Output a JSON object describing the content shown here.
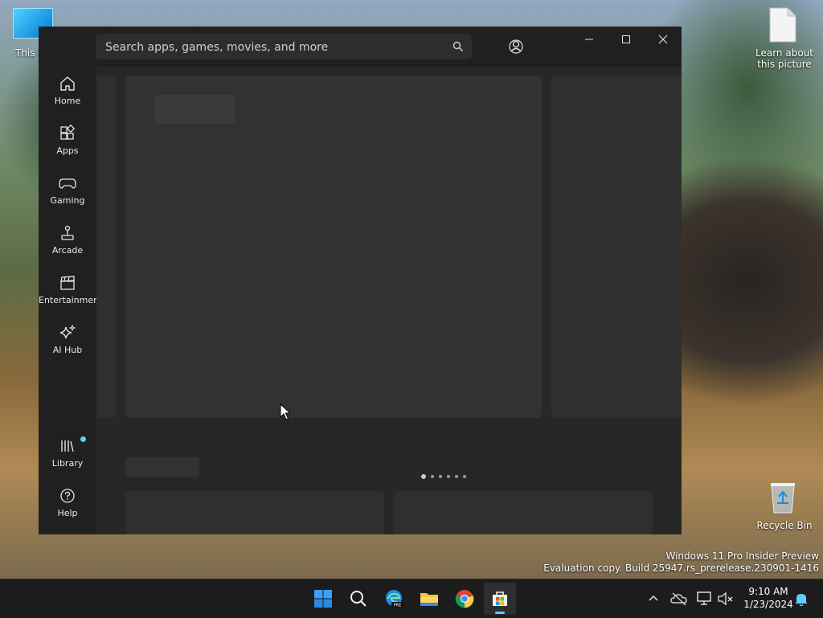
{
  "desktop": {
    "this_pc_label": "This PC",
    "learn_label": "Learn about this picture",
    "recycle_label": "Recycle Bin",
    "watermark_line1": "Windows 11 Pro Insider Preview",
    "watermark_line2": "Evaluation copy. Build 25947.rs_prerelease.230901-1416"
  },
  "store": {
    "search": {
      "placeholder": "Search apps, games, movies, and more"
    },
    "nav": [
      {
        "label": "Home",
        "icon": "home-icon"
      },
      {
        "label": "Apps",
        "icon": "apps-icon"
      },
      {
        "label": "Gaming",
        "icon": "gamepad-icon"
      },
      {
        "label": "Arcade",
        "icon": "joystick-icon"
      },
      {
        "label": "Entertainment",
        "icon": "clapperboard-icon"
      },
      {
        "label": "AI Hub",
        "icon": "sparkle-icon"
      },
      {
        "label": "Library",
        "icon": "library-icon",
        "badge": true
      },
      {
        "label": "Help",
        "icon": "help-icon"
      }
    ],
    "carousel": {
      "pages": 6,
      "active_page": 1
    }
  },
  "taskbar": {
    "apps": [
      "start-icon",
      "search-icon",
      "edge-preview-icon",
      "file-explorer-icon",
      "chrome-icon",
      "store-icon"
    ],
    "time": "9:10 AM",
    "date": "1/23/2024"
  },
  "colors": {
    "window_bg": "#272727",
    "nav_bg": "#202020",
    "placeholder": "#323232",
    "accent": "#60cdff"
  }
}
